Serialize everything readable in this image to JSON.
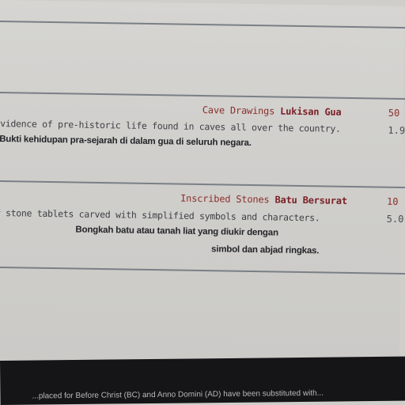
{
  "entries": [
    {
      "title_en": "Cave Drawings",
      "title_local": "Lukisan Gua",
      "desc_en": "Evidence of pre-historic life found in caves all over the country.",
      "desc_local": "Bukti kehidupan pra-sejarah di dalam gua di seluruh negara.",
      "col1": "50",
      "col2": "1.9"
    },
    {
      "title_en": "Inscribed Stones",
      "title_local": "Batu Bersurat",
      "desc_en": "r stone tablets carved with simplified symbols and characters.",
      "desc_local_line1": "Bongkah batu atau tanah liat yang diukir dengan",
      "desc_local_line2": "simbol dan abjad ringkas.",
      "col1": "10",
      "col2": "5.0"
    }
  ],
  "footer": {
    "text": "...placed for Before Christ (BC) and Anno Domini (AD) have been substituted with..."
  }
}
